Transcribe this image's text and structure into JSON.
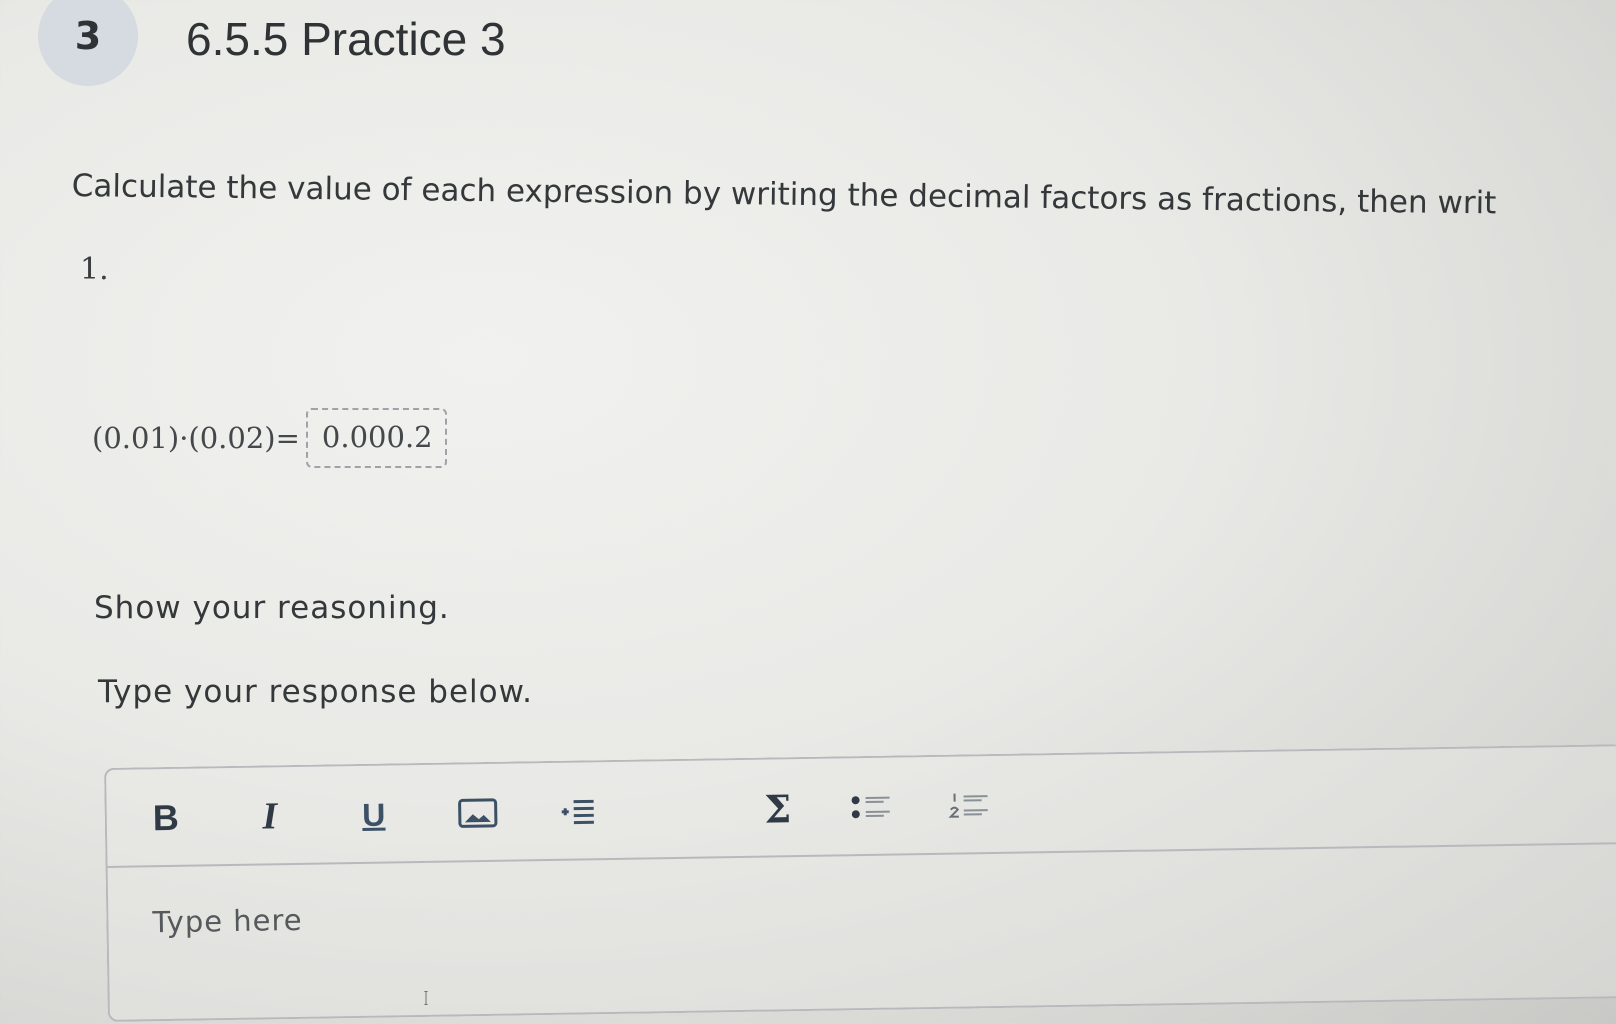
{
  "header": {
    "question_number": "3",
    "title": "6.5.5 Practice 3"
  },
  "instruction": "Calculate the value of each expression by writing the decimal factors as fractions, then writ",
  "item": {
    "number": "1.",
    "expression": "(0.01)·(0.02)=",
    "answer": "0.000.2"
  },
  "prompts": {
    "reasoning": "Show your reasoning.",
    "response": "Type your response below."
  },
  "toolbar": {
    "bold": "B",
    "italic": "I",
    "underline": "U",
    "sigma": "Σ"
  },
  "editor": {
    "placeholder": "Type here"
  },
  "colors": {
    "accent": "#d5dbe0",
    "text": "#2f3336",
    "border": "#b7babd"
  },
  "icons": {
    "image": "image-icon",
    "indent": "indent-icon",
    "equation": "sigma-icon",
    "bulleted_list": "bulleted-list-icon",
    "numbered_list": "numbered-list-icon",
    "cursor": "text-cursor-icon"
  }
}
